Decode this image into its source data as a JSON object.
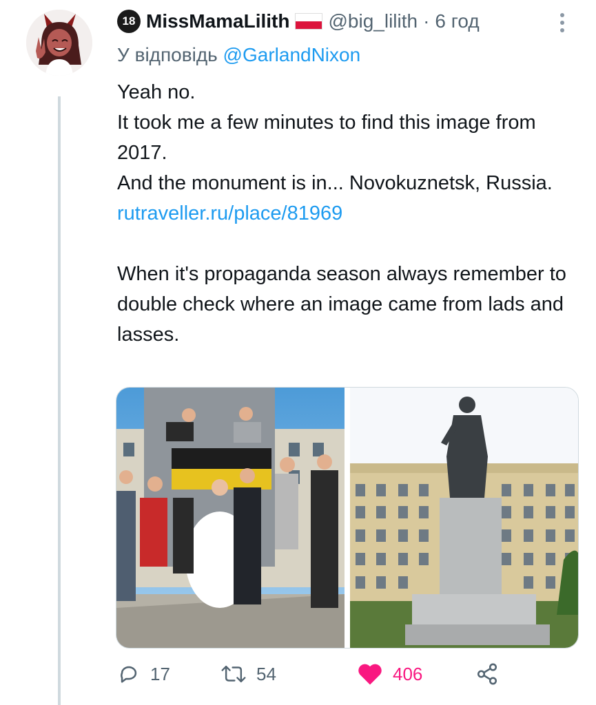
{
  "tweet": {
    "author": {
      "badge": "18",
      "display_name": "MissMamaLilith",
      "handle": "@big_lilith",
      "avatar_icon": "cartoon-devil-avatar"
    },
    "separator": "·",
    "time": "6 год",
    "reply_prefix": "У відповідь",
    "reply_to": "@GarlandNixon",
    "text": {
      "line1": "Yeah no.",
      "line2": "It took me a few minutes to find this image from 2017.",
      "line3": "And the monument is in... Novokuznetsk, Russia.",
      "link": "rutraveller.ru/place/81969",
      "line4": "When it's propaganda season always remember to double check where an image came from lads and lasses."
    },
    "media": [
      {
        "name": "wedding-group-photo"
      },
      {
        "name": "lenin-monument-photo"
      }
    ],
    "stats": {
      "replies": "17",
      "retweets": "54",
      "likes": "406"
    },
    "colors": {
      "link": "#1d9bf0",
      "like": "#f91880",
      "muted": "#536471"
    }
  }
}
